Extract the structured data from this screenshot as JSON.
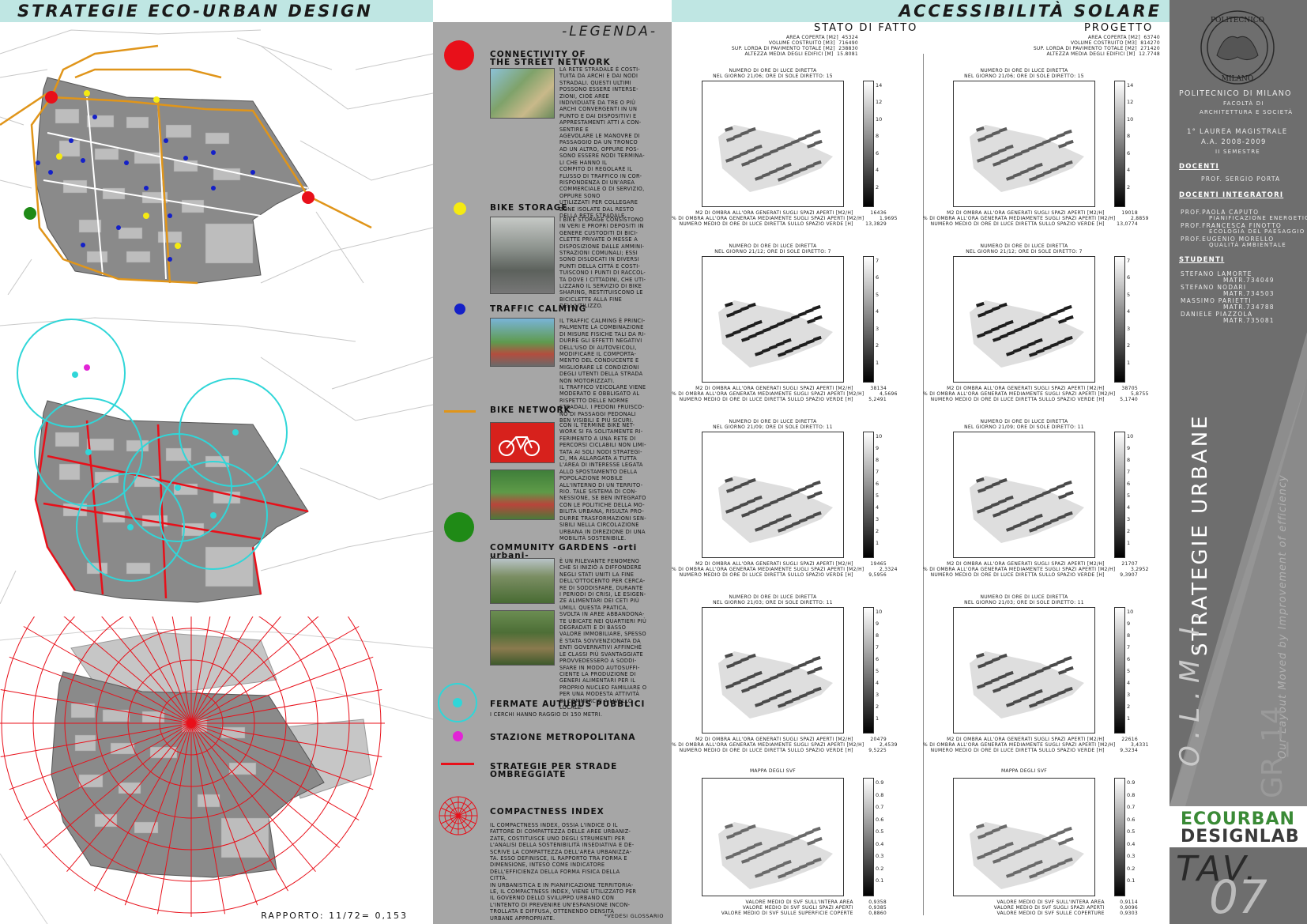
{
  "header": {
    "left_title": "STRATEGIE ECO-URBAN DESIGN",
    "right_title": "ACCESSIBILITÀ SOLARE"
  },
  "map_ratio": "RAPPORTO: 11/72= 0,153",
  "legend": {
    "title": "-LEGENDA-",
    "connectivity": {
      "title_line1": "CONNECTIVITY OF",
      "title_line2": "THE STREET NETWORK",
      "text": "La rete stradale è costi-\ntuita da archi e dai nodi\nstradali. Questi ultimi\npossono essere interse-\nzioni, cioè aree\nindividuate da tre o più\narchi convergenti in un\npunto e dai dispositivi e\napprestamenti atti a con-\nsentire e\nagevolare le manovre di\npassaggio da un tronco\nad un altro, oppure pos-\nsono essere nodi termina-\nli che hanno il\ncompito di regolare il\nflusso di traffico in cor-\nrispondenza di un'area\ncommerciale o di servizio,\noppure sono\nutilizzati per collegare\nzone isolate dal resto\ndella rete stradale."
    },
    "bike_storage": {
      "title": "BIKE STORAGE",
      "text": "I bike storage consistono\nin veri e propri depositi in\ngenere custoditi di bici-\nclette private o messe a\ndisposizione dalle ammini-\nstrazioni comunali; essi\nsono dislocati in diversi\npunti della città e costi-\ntuiscono i punti di raccol-\nta dove i cittadini, che uti-\nlizzano il servizio di bike\nsharing, restituiscono le\nbiciclette alla fine\ndell'utilizzo."
    },
    "traffic_calming": {
      "title": "TRAFFIC CALMING",
      "text": "Il traffic calming è princi-\npalmente la combinazione\ndi misure fisiche tali da ri-\ndurre gli effetti negativi\ndell'uso di autoveicoli,\nmodificare il comporta-\nmento del conducente e\nmigliorare le condizioni\ndegli utenti della strada\nnon motorizzati.\nIl traffico veicolare viene\nmoderato e obbligato al\nrispetto delle norme\nstradali. I pedoni fruisco-\nno di passaggi pedonali\nben visibili e più sicuri."
    },
    "bike_network": {
      "title": "BIKE NETWORK",
      "text": "Con il termine Bike Net-\nwork si fa solitamente ri-\nferimento a una rete di\npercorsi ciclabili non limi-\ntata ai soli nodi strategi-\nci, ma allargata a tutta\nl'area di interesse legata\nallo spostamento della\npopolazione mobile\nall'interno di un territo-\nrio. Tale sistema di con-\nnessione, se ben integrato\ncon le politiche della mo-\nbilità urbana, risulta pro-\ndurre trasformazioni sen-\nsibili nella circolazione\nurbana in direzione di una\nmobilità sostenibile."
    },
    "community_gardens": {
      "title": "COMMUNITY GARDENS -orti urbani-",
      "text": "È un rilevante fenomeno\nche si iniziò a diffondere\nnegli Stati Uniti la fine\ndell'Ottocento per cerca-\nre di soddisfare, durante\ni periodi di crisi, le esigen-\nze alimentari dei ceti più\numili. Questa pratica,\nsvolta in aree abbandona-\nte ubicate nei quartieri più\ndegradati e di basso\nvalore immobiliare, spesso\nè stata sovvenzionata da\nenti governativi affinché\nle classi più svantaggiate\nprovvedessero a soddi-\nsfare in modo autosuffi-\nciente la produzione di\ngeneri alimentari per il\nproprio nucleo familiare o\nper una modesta attività\ndi commercio a livello\nlocale."
    },
    "bus_stops": {
      "title": "FERMATE AUTUBUS PUBBLICI",
      "text": "I cerchi hanno raggio di 150 metri."
    },
    "metro": {
      "title": "STAZIONE METROPOLITANA"
    },
    "shaded_streets": {
      "title_line1": "STRATEGIE PER STRADE",
      "title_line2": "OMBREGGIATE"
    },
    "compactness": {
      "title": "COMPACTNESS INDEX",
      "text": "Il compactness index, ossia l'indice o il\nfattore di compattezza delle aree urbaniz-\nzate, costituisce uno degli strumenti per\nl'analisi della sostenibilità insediativa e de-\nscrive la compattezza dell'area urbanizza-\nta. Esso definisce, il rapporto tra forma e\ndimensione, inteso come indicatore\ndell'efficienza della forma fisica della\ncittà.\nIn urbanistica e in pianificazione territoria-\nle, il compactness index, viene utilizzato per\nil governo dello sviluppo urbano con\nl'intento di prevenire un'espansione incon-\ntrollata e diffusa, ottenendo densità\nurbane appropriate."
    },
    "footnote": "*VEDESI GLOSSARIO"
  },
  "solar": {
    "stato": {
      "heading": "STATO DI FATTO",
      "stats": [
        {
          "label": "area coperta [m2]",
          "value": "45324"
        },
        {
          "label": "volume costruito [m3]",
          "value": "716490"
        },
        {
          "label": "sup. lorda di pavimento totale [m2]",
          "value": "238830"
        },
        {
          "label": "altezza media degli edifici [m]",
          "value": "15.8081"
        }
      ],
      "charts": [
        {
          "cap1": "numero di ore di luce diretta",
          "cap2": "nel giorno 21/06; ore di sole diretto: 15",
          "vals": [
            "16436",
            "1,9695",
            "13,3829"
          ]
        },
        {
          "cap1": "numero di ore di luce diretta",
          "cap2": "nel giorno 21/12; ore di sole diretto: 7",
          "vals": [
            "38134",
            "4,5696",
            "5,2491"
          ]
        },
        {
          "cap1": "numero di ore di luce diretta",
          "cap2": "nel giorno 21/09; ore di sole diretto: 11",
          "vals": [
            "19465",
            "2,3324",
            "9,5956"
          ]
        },
        {
          "cap1": "numero di ore di luce diretta",
          "cap2": "nel giorno 21/03; ore di sole diretto: 11",
          "vals": [
            "20479",
            "2,4539",
            "9,5225"
          ]
        }
      ],
      "svf": {
        "cap": "mappa degli SVF",
        "vals": [
          "0,9358",
          "0,9385",
          "0,8860"
        ]
      }
    },
    "progetto": {
      "heading": "PROGETTO",
      "stats": [
        {
          "label": "area coperta [m2]",
          "value": "63740"
        },
        {
          "label": "volume costruito [m3]",
          "value": "814270"
        },
        {
          "label": "sup. lorda di pavimento totale [m2]",
          "value": "271420"
        },
        {
          "label": "altezza media degli edifici [m]",
          "value": "12.7748"
        }
      ],
      "charts": [
        {
          "cap1": "numero di ore di luce diretta",
          "cap2": "nel giorno 21/06; ore di sole diretto: 15",
          "vals": [
            "19018",
            "2,8859",
            "13,0774"
          ]
        },
        {
          "cap1": "numero di ore di luce diretta",
          "cap2": "nel giorno 21/12; ore di sole diretto: 7",
          "vals": [
            "38705",
            "5,8755",
            "5,1740"
          ]
        },
        {
          "cap1": "numero di ore di luce diretta",
          "cap2": "nel giorno 21/09; ore di sole diretto: 11",
          "vals": [
            "21707",
            "3,2952",
            "9,3907"
          ]
        },
        {
          "cap1": "numero di ore di luce diretta",
          "cap2": "nel giorno 21/03; ore di sole diretto: 11",
          "vals": [
            "22616",
            "3,4331",
            "9,3234"
          ]
        }
      ],
      "svf": {
        "cap": "mappa degli SVF",
        "vals": [
          "0,9114",
          "0,9096",
          "0,9303"
        ]
      }
    },
    "row_labels": [
      "m2 di ombra all'ora generati sugli spazi aperti [m2/h]",
      "% di ombra all'ora generata mediamente sugli spazi aperti [m2/h]",
      "numero medio di ore di luce diretta sullo spazio verde [h]"
    ],
    "svf_labels_stato": [
      "valore medio di SVF sull'intera area",
      "valore medio di SVF sugli spazi aperti",
      "valore medio di SVF sulle superficie coperte"
    ],
    "svf_labels_progetto": [
      "valore medio di SVF sull'intera area",
      "valore medio di SVF sugli spazi aperti",
      "valore medio di SVF sulle coperture"
    ],
    "colorbar_ticks_a": [
      "14",
      "12",
      "10",
      "8",
      "6",
      "4",
      "2"
    ],
    "colorbar_ticks_b": [
      "7",
      "6",
      "5",
      "4",
      "3",
      "2",
      "1"
    ],
    "colorbar_ticks_c": [
      "10",
      "9",
      "8",
      "7",
      "6",
      "5",
      "4",
      "3",
      "2",
      "1"
    ],
    "colorbar_ticks_d": [
      "0.9",
      "0.8",
      "0.7",
      "0.6",
      "0.5",
      "0.4",
      "0.3",
      "0.2",
      "0.1"
    ]
  },
  "sidebar": {
    "seal_top": "POLITECNICO",
    "seal_bottom": "MILANO",
    "university": "Politecnico di Milano",
    "faculty1": "facoltà di",
    "faculty2": "architettura e società",
    "degree1": "1° laurea magistrale",
    "degree2": "A.A. 2008-2009",
    "degree3": "II semestre",
    "docenti_h": "DOCENTI",
    "docente": "Prof. Sergio Porta",
    "integratori_h": "DOCENTI INTEGRATORI",
    "integratori": [
      "Prof.Paola Caputo",
      "pianificazione energetica",
      "Prof.Francesca Finotto",
      "ecologia del paesaggio",
      "Prof.Eugenio Morello",
      "qualità ambientale"
    ],
    "studenti_h": "STUDENTI",
    "studenti": [
      "Stefano Lamorte",
      "matr.734049",
      "Stefano Nodari",
      "matr.734503",
      "Massimo Parietti",
      "matr.734788",
      "Daniele Piazzola",
      "matr.735081"
    ],
    "vertical_title": "STRATEGIE URBANE",
    "vertical_olmi": "O.L.M.I.",
    "vertical_sub": "Our Layout Moved by Improvement of efficiency",
    "vertical_gr": "GR_14",
    "logo_line1": "ECOURBAN",
    "logo_line2": "DESIGNLAB",
    "tav_label": "TAV.",
    "tav_num": "07"
  },
  "colors": {
    "header_bg": "#bfe6e3",
    "legend_bg": "#a6a6a6",
    "sidebar_bg": "#6e6e6e",
    "red": "#e8101a",
    "yellow": "#f5ea12",
    "blue": "#1420c8",
    "green": "#1f8a16",
    "cyan": "#30d6d8",
    "magenta": "#e224d6",
    "orange": "#e0951a"
  }
}
